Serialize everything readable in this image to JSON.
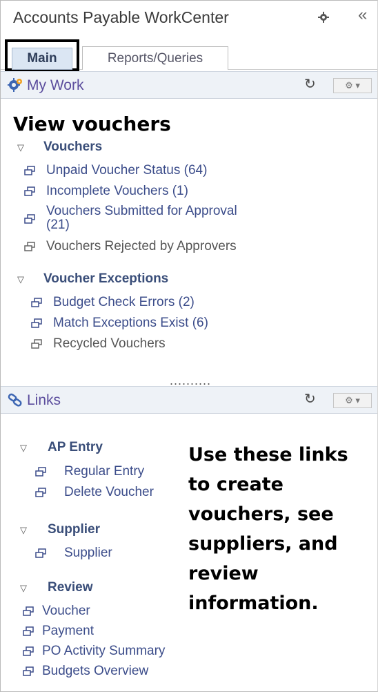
{
  "workcenter": {
    "title": "Accounts Payable WorkCenter",
    "collapse_glyph": "«",
    "tabs": [
      {
        "label": "Main",
        "active": true
      },
      {
        "label": "Reports/Queries",
        "active": false
      }
    ]
  },
  "my_work": {
    "title": "My Work",
    "refresh_glyph": "↻",
    "options_glyph": "⚙ ▾",
    "heading": "View vouchers",
    "groups": [
      {
        "label": "Vouchers",
        "items": [
          {
            "label": "Unpaid Voucher Status (64)"
          },
          {
            "label": "Incomplete Vouchers (1)"
          },
          {
            "label": "Vouchers Submitted for Approval",
            "label_line2": "(21)"
          },
          {
            "label": "Vouchers Rejected by Approvers"
          }
        ]
      },
      {
        "label": "Voucher Exceptions",
        "items": [
          {
            "label": "Budget Check Errors (2)"
          },
          {
            "label": "Match Exceptions Exist (6)"
          },
          {
            "label": "Recycled Vouchers"
          }
        ]
      }
    ]
  },
  "divider": "..........",
  "links": {
    "title": "Links",
    "refresh_glyph": "↻",
    "options_glyph": "⚙ ▾",
    "groups": [
      {
        "label": "AP Entry",
        "items": [
          {
            "label": "Regular Entry"
          },
          {
            "label": "Delete Voucher"
          }
        ]
      },
      {
        "label": "Supplier",
        "items": [
          {
            "label": "Supplier"
          }
        ]
      },
      {
        "label": "Review",
        "items": [
          {
            "label": "Voucher"
          },
          {
            "label": "Payment"
          },
          {
            "label": "PO Activity Summary"
          },
          {
            "label": "Budgets Overview"
          }
        ]
      }
    ]
  },
  "annotation": {
    "lines": [
      "Use these links",
      "to create",
      "vouchers, see",
      "suppliers, and",
      "review",
      "information."
    ]
  },
  "colors": {
    "link": "#3b4c8a",
    "pagelet_title": "#5b4d9d",
    "tab_active_bg": "#dbe6f3",
    "highlight_box": "#000000"
  }
}
